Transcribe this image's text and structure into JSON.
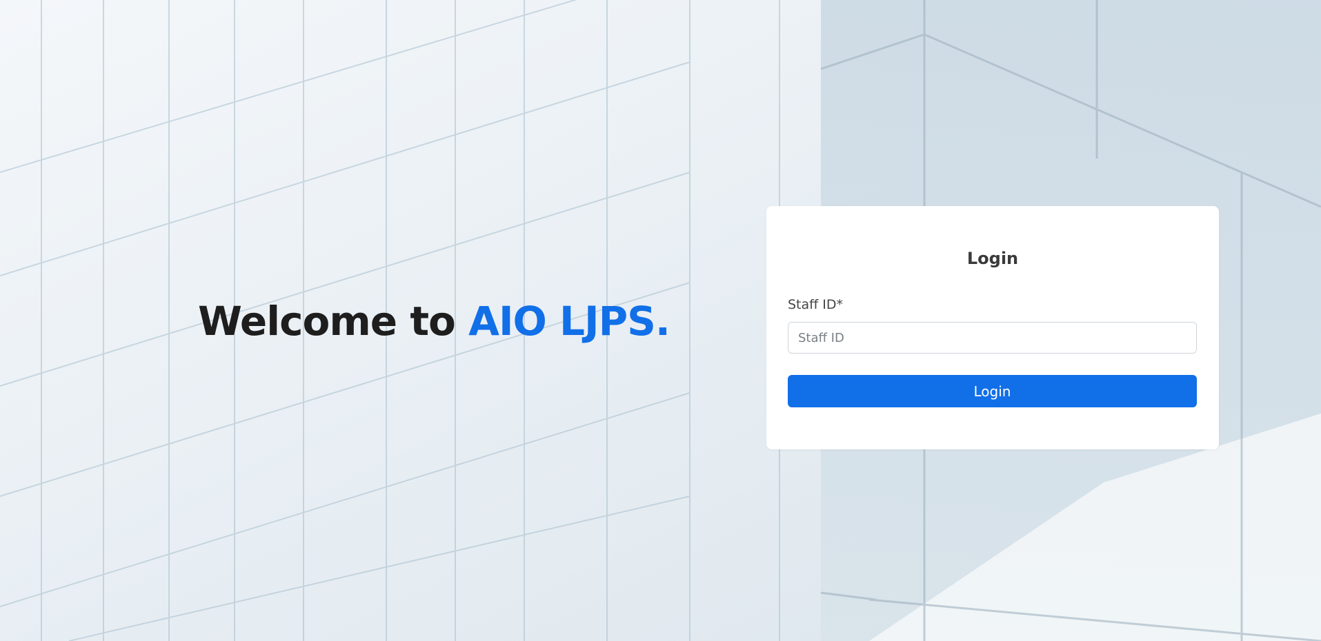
{
  "welcome": {
    "prefix": "Welcome to ",
    "brand": "AIO LJPS."
  },
  "login_card": {
    "title": "Login",
    "staff_id_label": "Staff ID*",
    "staff_id_placeholder": "Staff ID",
    "staff_id_value": "",
    "submit_label": "Login"
  },
  "colors": {
    "accent": "#116fe8",
    "heading_dark": "#1e1e1e",
    "card_bg": "#ffffff"
  }
}
